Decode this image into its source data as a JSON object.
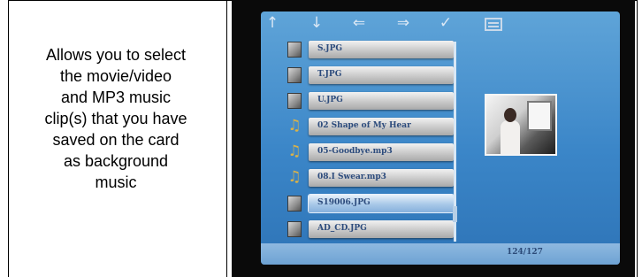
{
  "description": {
    "lines": [
      "Allows you to select",
      "the movie/video",
      "and MP3 music",
      "clip(s) that you have",
      "saved on the card",
      "as background",
      "music"
    ]
  },
  "screen": {
    "toolbar": {
      "icons": [
        "up-arrow-icon",
        "down-arrow-icon",
        "left-arrow-icon",
        "right-arrow-icon",
        "check-icon",
        "list-icon"
      ]
    },
    "files": [
      {
        "name": "S.JPG",
        "type": "image"
      },
      {
        "name": "T.JPG",
        "type": "image"
      },
      {
        "name": "U.JPG",
        "type": "image"
      },
      {
        "name": "02 Shape of My Hear",
        "type": "music"
      },
      {
        "name": "05-Goodbye.mp3",
        "type": "music"
      },
      {
        "name": "08.I Swear.mp3",
        "type": "music"
      },
      {
        "name": "S19006.JPG",
        "type": "image",
        "selected": true
      },
      {
        "name": "AD_CD.JPG",
        "type": "image"
      }
    ],
    "counter": "124/127"
  },
  "colors": {
    "screen_blue": "#3b86c8",
    "item_text": "#2c4b7c",
    "selected_bar": "#a8c8e8"
  }
}
